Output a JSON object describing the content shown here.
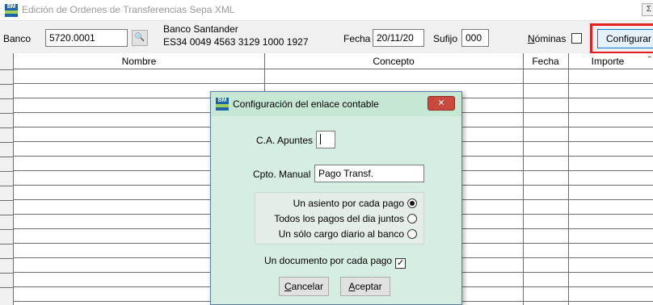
{
  "window": {
    "title": "Edición de Ordenes de Transferencias Sepa XML",
    "app_icon": "BM",
    "corner_button": "Σ"
  },
  "toolbar": {
    "banco_label": "Banco",
    "banco_value": "5720.0001",
    "search_icon": "binoculars-icon",
    "bank_name": "Banco Santander",
    "bank_iban": "ES34 0049 4563 3129 1000 1927",
    "fecha_label": "Fecha",
    "fecha_value": "20/11/20",
    "sufijo_label": "Sufijo",
    "sufijo_value": "000",
    "nominas_label": "Nóminas",
    "nominas_checked": false,
    "configurar_label": "Configurar",
    "highlight_color": "#e02020"
  },
  "grid": {
    "columns": [
      "Nombre",
      "Concepto",
      "Fecha",
      "Importe"
    ],
    "rows": []
  },
  "dialog": {
    "title": "Configuración del enlace contable",
    "close_label": "✕",
    "ca_apuntes_label": "C.A. Apuntes",
    "ca_apuntes_value": "",
    "cpto_label": "Cpto. Manual",
    "cpto_value": "Pago Transf.",
    "options": [
      {
        "label": "Un asiento por cada pago",
        "selected": true
      },
      {
        "label": "Todos los pagos del dia juntos",
        "selected": false
      },
      {
        "label": "Un sólo cargo diario al banco",
        "selected": false
      }
    ],
    "documento_label": "Un documento por cada pago",
    "documento_checked": true,
    "cancel_label": "Cancelar",
    "accept_label": "Aceptar",
    "background": "#d6eee1"
  }
}
